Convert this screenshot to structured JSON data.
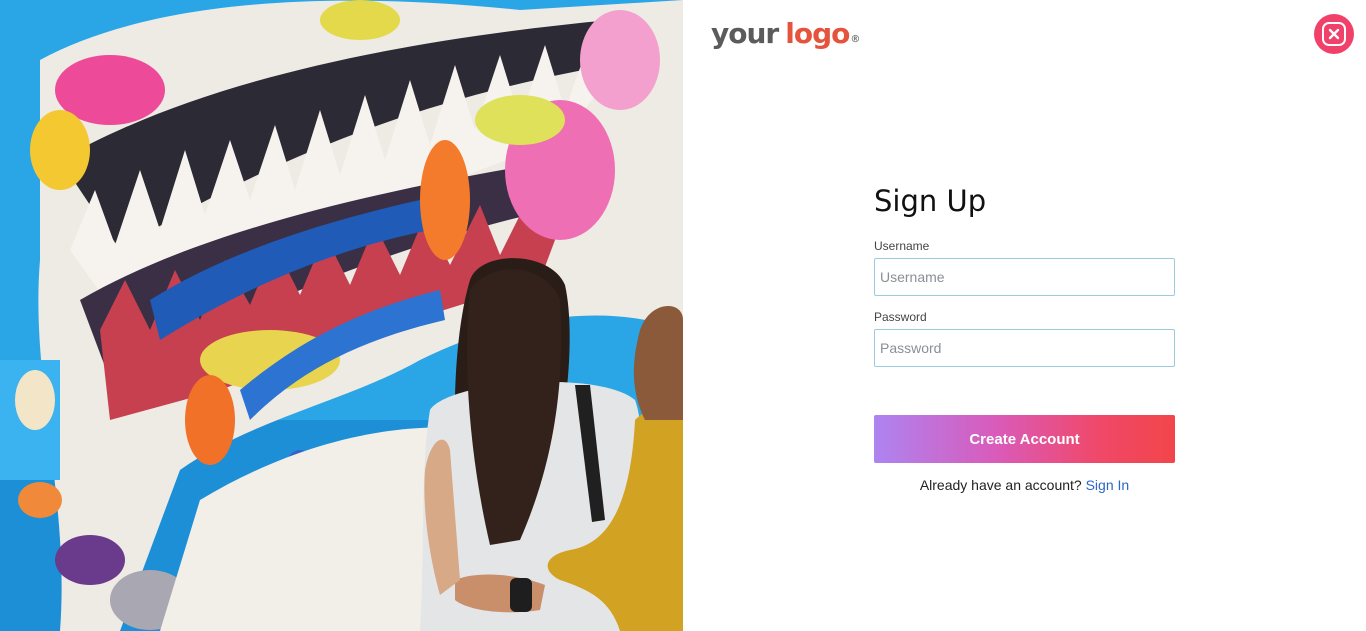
{
  "hero": {
    "image_description_icon": "mural-photo"
  },
  "logo": {
    "word1": "your",
    "word2": "logo",
    "registered": "®"
  },
  "close_icon": "close-icon",
  "form": {
    "title": "Sign Up",
    "username_label": "Username",
    "username_placeholder": "Username",
    "username_value": "",
    "password_label": "Password",
    "password_placeholder": "Password",
    "password_value": "",
    "submit_label": "Create Account",
    "have_account_text": "Already have an account?",
    "signin_link": "Sign In"
  },
  "colors": {
    "accent_pink": "#f1416a",
    "gradient_start": "#ad84f1",
    "gradient_end": "#f2454a",
    "link_blue": "#2b66c9",
    "logo_red": "#e5533d"
  }
}
